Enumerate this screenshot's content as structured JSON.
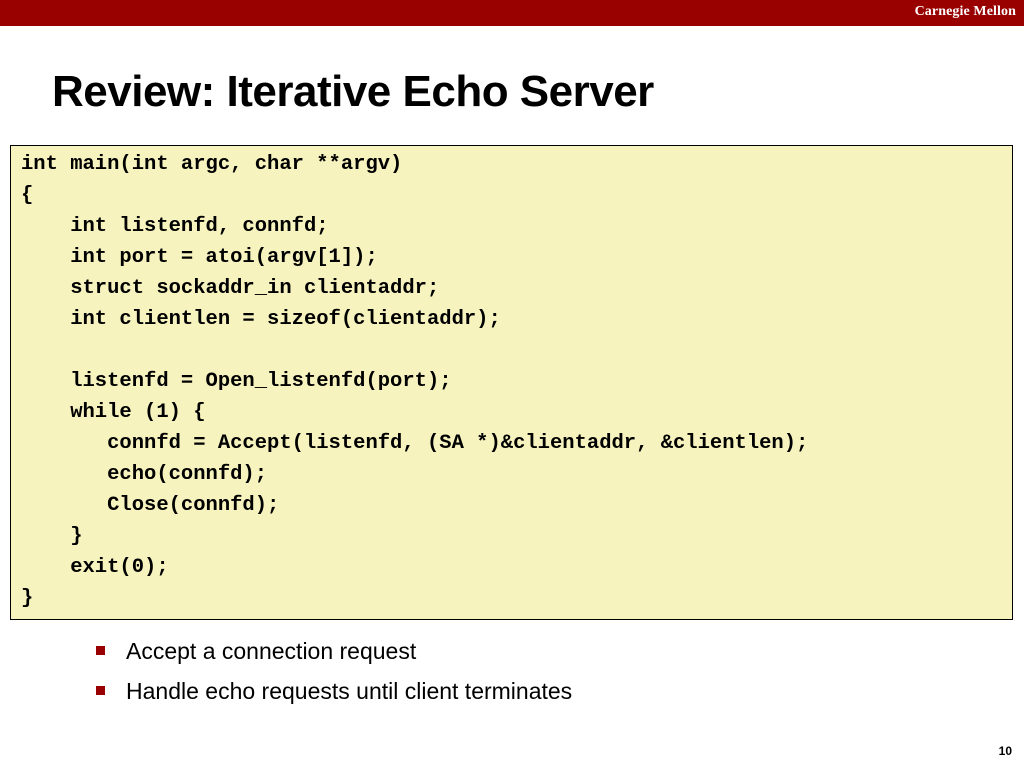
{
  "header": {
    "brand": "Carnegie Mellon",
    "bar_color": "#990000"
  },
  "slide": {
    "title": "Review: Iterative Echo Server",
    "page_number": "10"
  },
  "code": {
    "background_color": "#f7f3bf",
    "lines": [
      "int main(int argc, char **argv)",
      "{",
      "    int listenfd, connfd;",
      "    int port = atoi(argv[1]);",
      "    struct sockaddr_in clientaddr;",
      "    int clientlen = sizeof(clientaddr);",
      "",
      "    listenfd = Open_listenfd(port);",
      "    while (1) {",
      "       connfd = Accept(listenfd, (SA *)&clientaddr, &clientlen);",
      "       echo(connfd);",
      "       Close(connfd);",
      "    }",
      "    exit(0);",
      "}"
    ]
  },
  "bullets": [
    {
      "text": "Accept a connection request",
      "marker_icon": "square-bullet-icon"
    },
    {
      "text": "Handle echo requests until client terminates",
      "marker_icon": "square-bullet-icon"
    }
  ]
}
